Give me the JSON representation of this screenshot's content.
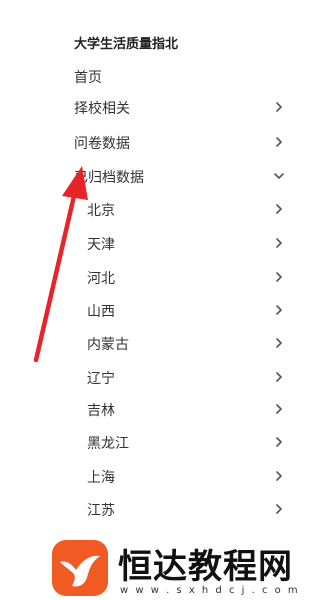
{
  "site_title": "大学生活质量指北",
  "menu": {
    "items": [
      {
        "label": "首页",
        "chevron": "none"
      },
      {
        "label": "择校相关",
        "chevron": "right"
      },
      {
        "label": "问卷数据",
        "chevron": "right"
      },
      {
        "label": "已归档数据",
        "chevron": "down"
      }
    ],
    "archived_children": [
      {
        "label": "北京"
      },
      {
        "label": "天津"
      },
      {
        "label": "河北"
      },
      {
        "label": "山西"
      },
      {
        "label": "内蒙古"
      },
      {
        "label": "辽宁"
      },
      {
        "label": "吉林"
      },
      {
        "label": "黑龙江"
      },
      {
        "label": "上海"
      },
      {
        "label": "江苏"
      }
    ]
  },
  "watermark": {
    "name": "恒达教程网",
    "url": "w w w . s x h d c j . c o m",
    "logo_icon": "whale-tail-icon",
    "brand_color": "#f15a22"
  },
  "annotation": {
    "icon": "red-arrow-icon",
    "color": "#e8232a"
  },
  "colors": {
    "text": "#333333",
    "chevron": "#555555"
  }
}
